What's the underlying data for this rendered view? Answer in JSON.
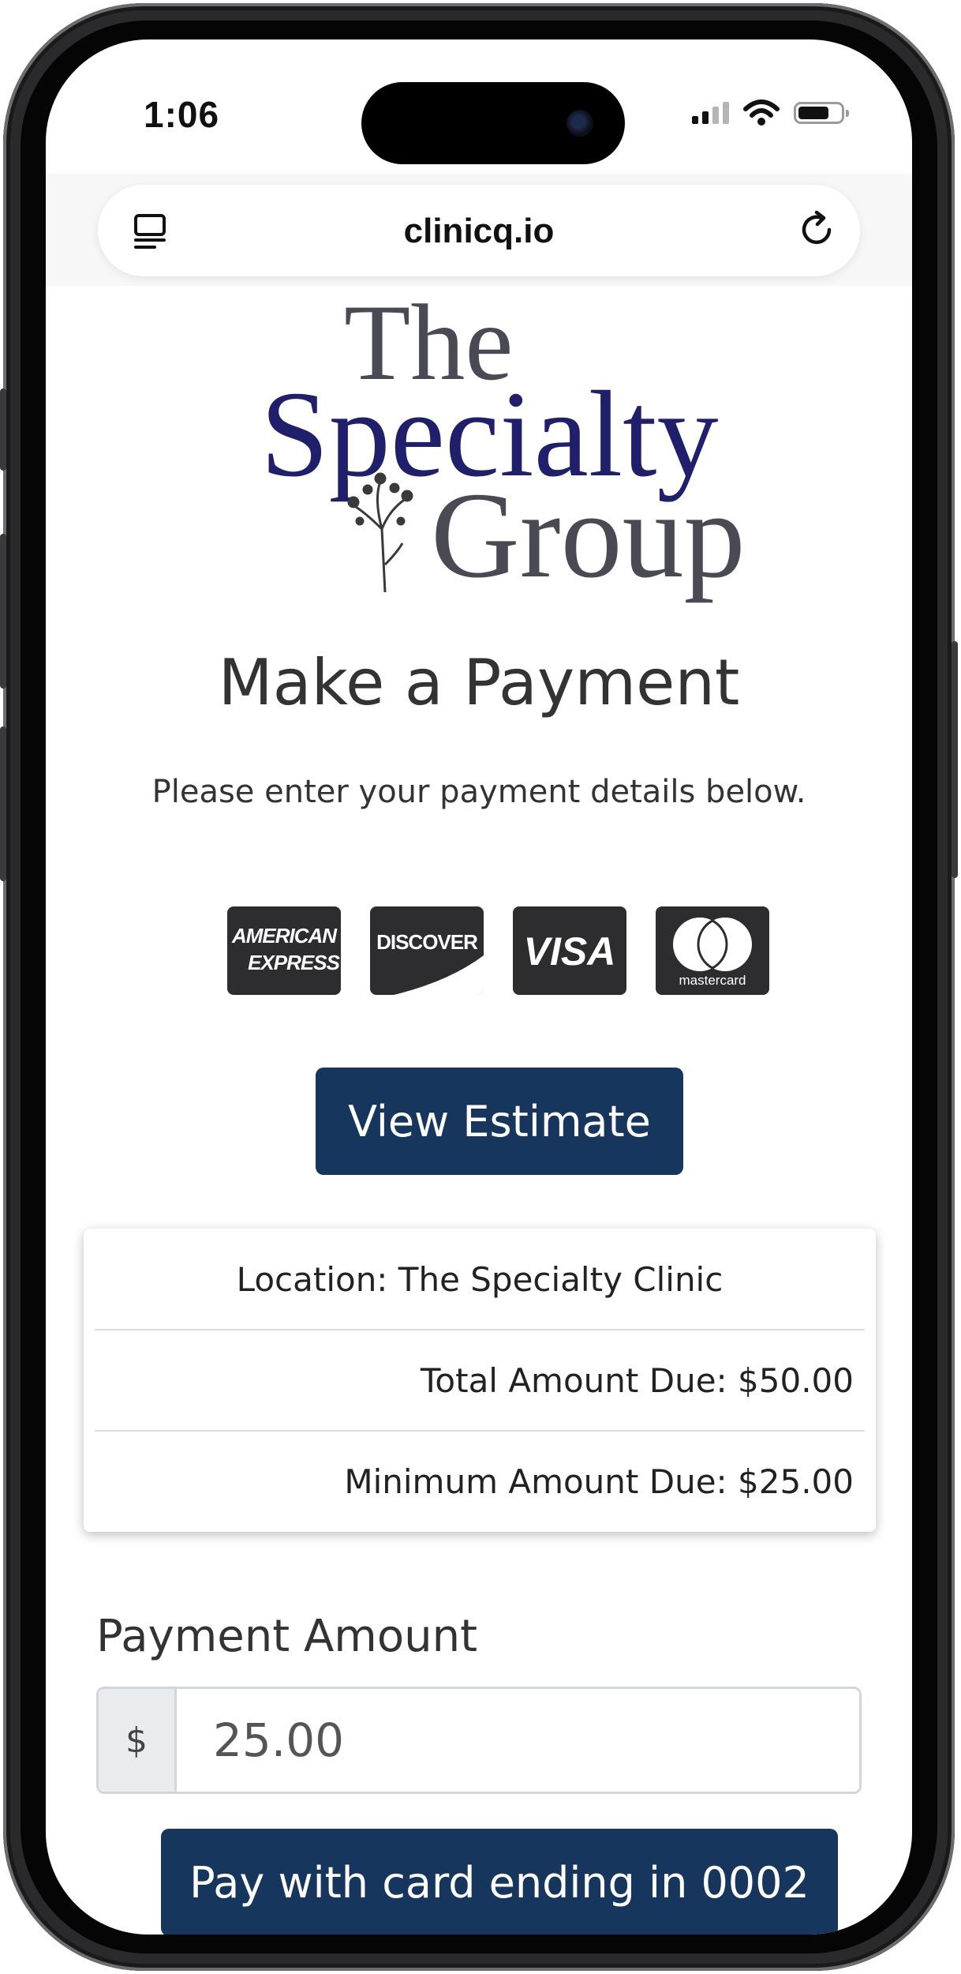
{
  "status_bar": {
    "time": "1:06"
  },
  "browser": {
    "url": "clinicq.io"
  },
  "logo": {
    "line1": "The",
    "line2": "Specialty",
    "line3": "Group"
  },
  "page": {
    "title": "Make a Payment",
    "subtitle": "Please enter your payment details below."
  },
  "cards": {
    "amex_line1": "AMERICAN",
    "amex_line2": "EXPRESS",
    "discover": "DISCOVER",
    "visa": "VISA",
    "mastercard": "mastercard"
  },
  "actions": {
    "view_estimate": "View Estimate",
    "pay_button": "Pay with card ending in 0002"
  },
  "summary": {
    "location": "Location: The Specialty Clinic",
    "total_due": "Total Amount Due: $50.00",
    "minimum_due": "Minimum Amount Due: $25.00"
  },
  "payment": {
    "label": "Payment Amount",
    "currency": "$",
    "value": "25.00"
  },
  "colors": {
    "primary_button": "#17365d",
    "logo_navy": "#1f1f6b",
    "logo_gray": "#4a4a55"
  }
}
